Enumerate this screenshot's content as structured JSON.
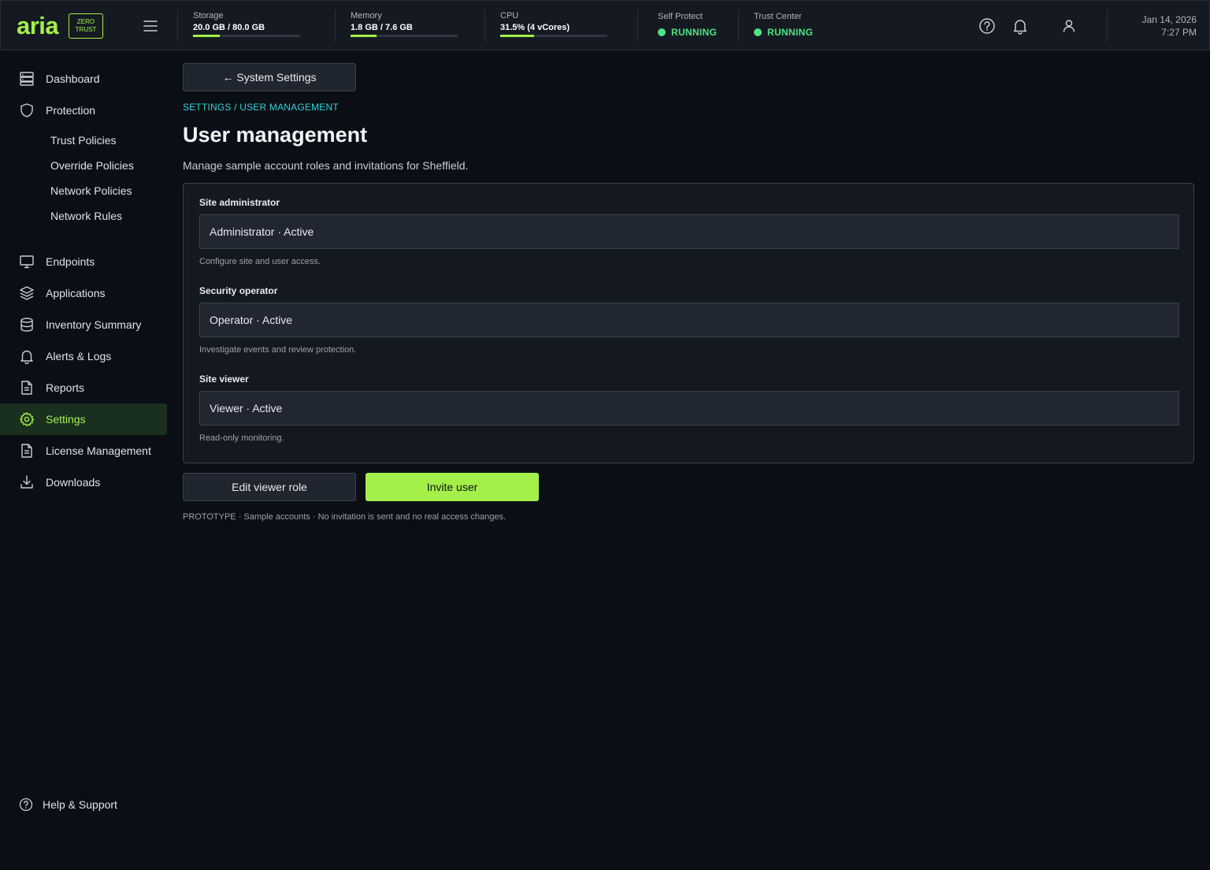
{
  "brand": {
    "logo": "aria",
    "badge_line1": "ZERO",
    "badge_line2": "TRUST"
  },
  "topbar": {
    "storage": {
      "label": "Storage",
      "value": "20.0 GB / 80.0 GB",
      "fraction": 0.25
    },
    "memory": {
      "label": "Memory",
      "value": "1.8 GB / 7.6 GB",
      "fraction": 0.24
    },
    "cpu": {
      "label": "CPU",
      "value": "31.5% (4 vCores)",
      "fraction": 0.315
    },
    "self_protect": {
      "label": "Self Protect",
      "status": "RUNNING"
    },
    "trust_center": {
      "label": "Trust Center",
      "status": "RUNNING"
    },
    "date": "Jan 14, 2026",
    "time": "7:27 PM",
    "colors": {
      "accent": "#a3f04a",
      "running": "#4ee57f"
    }
  },
  "sidebar": {
    "items": {
      "dashboard": "Dashboard",
      "protection": "Protection",
      "trust_policies": "Trust Policies",
      "override_policies": "Override Policies",
      "network_policies": "Network Policies",
      "network_rules": "Network Rules",
      "endpoints": "Endpoints",
      "applications": "Applications",
      "inventory_summary": "Inventory Summary",
      "alerts_logs": "Alerts & Logs",
      "reports": "Reports",
      "settings": "Settings",
      "license_management": "License Management",
      "downloads": "Downloads"
    },
    "active": "Settings",
    "help": "Help & Support"
  },
  "main": {
    "back_button": "← System Settings",
    "breadcrumb": "SETTINGS / USER MANAGEMENT",
    "title": "User management",
    "subtitle": "Manage sample account roles and invitations for Sheffield.",
    "roles": [
      {
        "label": "Site administrator",
        "value": "Administrator · Active",
        "helper": "Configure site and user access."
      },
      {
        "label": "Security operator",
        "value": "Operator · Active",
        "helper": "Investigate events and review protection."
      },
      {
        "label": "Site viewer",
        "value": "Viewer · Active",
        "helper": "Read-only monitoring."
      }
    ],
    "edit_button": "Edit viewer role",
    "invite_button": "Invite user",
    "note": "PROTOTYPE · Sample accounts · No invitation is sent and no real access changes."
  }
}
